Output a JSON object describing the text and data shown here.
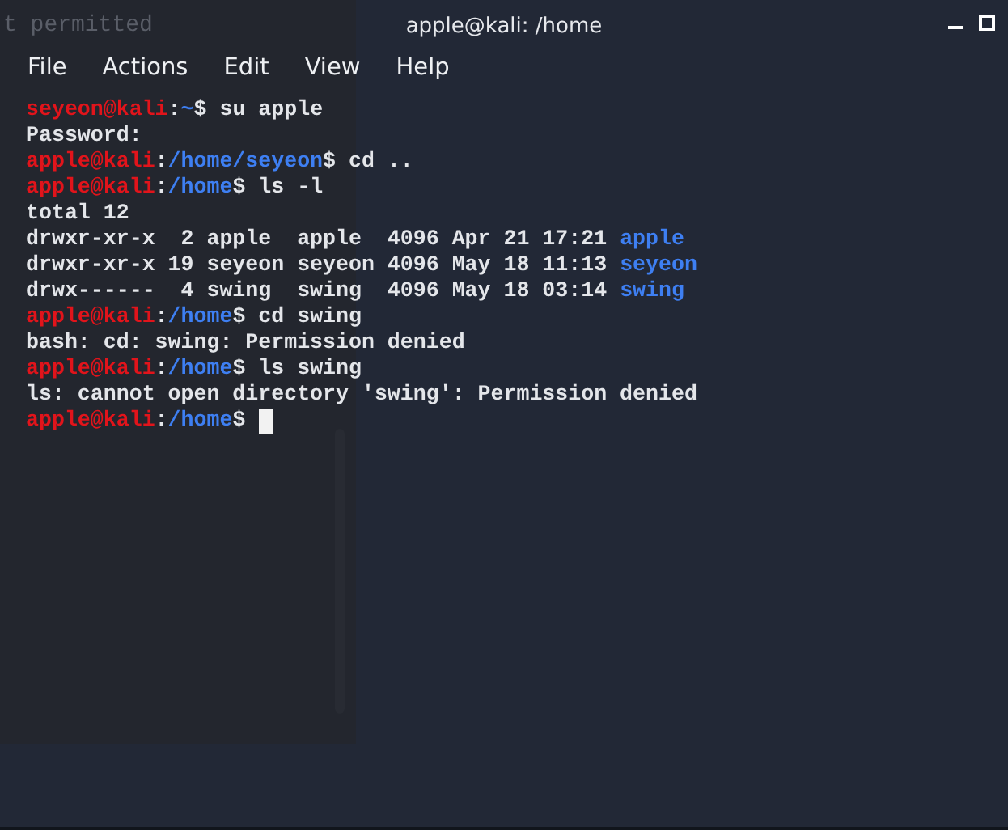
{
  "background_window": {
    "text": "t permitted"
  },
  "window": {
    "title": "apple@kali: /home"
  },
  "menu": [
    "File",
    "Actions",
    "Edit",
    "View",
    "Help"
  ],
  "terminal": {
    "lines": [
      {
        "segments": [
          {
            "kind": "user",
            "text": "seyeon@kali"
          },
          {
            "kind": "plain",
            "text": ":"
          },
          {
            "kind": "path",
            "text": "~"
          },
          {
            "kind": "plain",
            "text": "$ su apple"
          }
        ]
      },
      {
        "segments": [
          {
            "kind": "plain",
            "text": "Password:"
          }
        ]
      },
      {
        "segments": [
          {
            "kind": "user",
            "text": "apple@kali"
          },
          {
            "kind": "plain",
            "text": ":"
          },
          {
            "kind": "path",
            "text": "/home/seyeon"
          },
          {
            "kind": "plain",
            "text": "$ cd .."
          }
        ]
      },
      {
        "segments": [
          {
            "kind": "user",
            "text": "apple@kali"
          },
          {
            "kind": "plain",
            "text": ":"
          },
          {
            "kind": "path",
            "text": "/home"
          },
          {
            "kind": "plain",
            "text": "$ ls -l"
          }
        ]
      },
      {
        "segments": [
          {
            "kind": "plain",
            "text": "total 12"
          }
        ]
      },
      {
        "segments": [
          {
            "kind": "plain",
            "text": "drwxr-xr-x  2 apple  apple  4096 Apr 21 17:21 "
          },
          {
            "kind": "path",
            "text": "apple"
          }
        ]
      },
      {
        "segments": [
          {
            "kind": "plain",
            "text": "drwxr-xr-x 19 seyeon seyeon 4096 May 18 11:13 "
          },
          {
            "kind": "path",
            "text": "seyeon"
          }
        ]
      },
      {
        "segments": [
          {
            "kind": "plain",
            "text": "drwx------  4 swing  swing  4096 May 18 03:14 "
          },
          {
            "kind": "path",
            "text": "swing"
          }
        ]
      },
      {
        "segments": [
          {
            "kind": "user",
            "text": "apple@kali"
          },
          {
            "kind": "plain",
            "text": ":"
          },
          {
            "kind": "path",
            "text": "/home"
          },
          {
            "kind": "plain",
            "text": "$ cd swing"
          }
        ]
      },
      {
        "segments": [
          {
            "kind": "plain",
            "text": "bash: cd: swing: Permission denied"
          }
        ]
      },
      {
        "segments": [
          {
            "kind": "user",
            "text": "apple@kali"
          },
          {
            "kind": "plain",
            "text": ":"
          },
          {
            "kind": "path",
            "text": "/home"
          },
          {
            "kind": "plain",
            "text": "$ ls swing"
          }
        ]
      },
      {
        "segments": [
          {
            "kind": "plain",
            "text": "ls: cannot open directory 'swing': Permission denied"
          }
        ]
      },
      {
        "segments": [
          {
            "kind": "user",
            "text": "apple@kali"
          },
          {
            "kind": "plain",
            "text": ":"
          },
          {
            "kind": "path",
            "text": "/home"
          },
          {
            "kind": "plain",
            "text": "$ "
          }
        ],
        "cursor": true
      }
    ]
  }
}
